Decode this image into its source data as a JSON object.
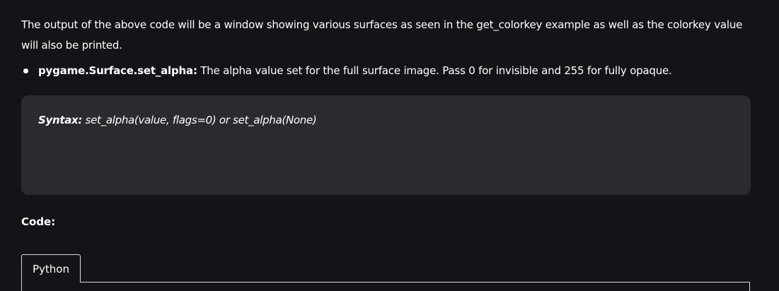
{
  "intro": {
    "text": "The output of the above code will be a window showing various surfaces as seen in the get_colorkey example as well as the colorkey value will also be printed."
  },
  "bullets": [
    {
      "term": "pygame.Surface.set_alpha:",
      "description": " The alpha value set for the full surface image.  Pass 0 for invisible and 255 for fully opaque."
    }
  ],
  "syntax": {
    "label": "Syntax:",
    "text": " set_alpha(value, flags=0) or set_alpha(None)"
  },
  "code_section": {
    "heading": "Code:",
    "tabs": [
      {
        "label": "Python"
      }
    ]
  },
  "colors": {
    "background": "#131417",
    "syntax_box": "#2a2b2e",
    "text": "#ffffff",
    "tab_border": "#d9d9d9"
  }
}
